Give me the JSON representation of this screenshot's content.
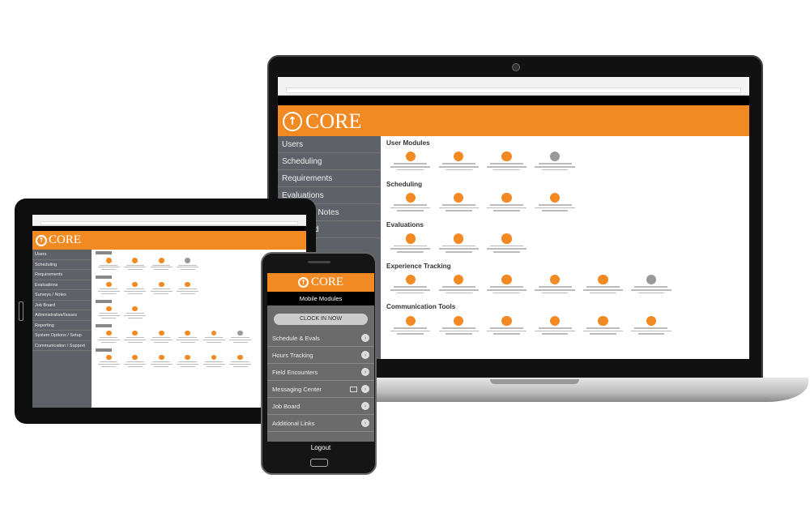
{
  "brand": {
    "name": "CORE",
    "accent": "#f28a24",
    "sidebar_bg": "#5e6167"
  },
  "laptop": {
    "sidebar": [
      "Users",
      "Scheduling",
      "Requirements",
      "Evaluations",
      "Surveys / Notes",
      "Job Board"
    ],
    "sections": [
      "User Modules",
      "Scheduling",
      "Evaluations",
      "Experience Tracking",
      "Communication Tools"
    ]
  },
  "tablet": {
    "sidebar": [
      "Users",
      "Scheduling",
      "Requirements",
      "Evaluations",
      "Surveys / Notes",
      "Job Board",
      "Administrative/Issues",
      "Reporting",
      "System Options / Setup",
      "Communication / Support"
    ]
  },
  "phone": {
    "title": "Mobile Modules",
    "clock_in": "CLOCK IN NOW",
    "items": [
      "Schedule & Evals",
      "Hours Tracking",
      "Field Encounters",
      "Messaging Center",
      "Job Board",
      "Additional Links"
    ],
    "logout": "Logout"
  }
}
